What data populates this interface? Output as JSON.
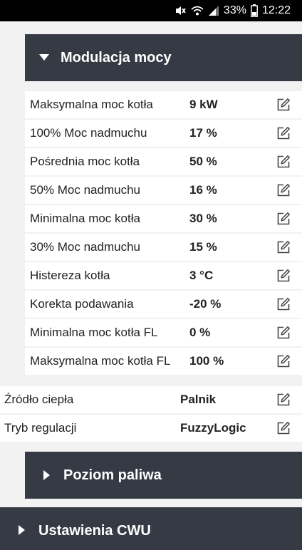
{
  "status_bar": {
    "battery": "33%",
    "time": "12:22"
  },
  "sections": {
    "modulacja": {
      "title": "Modulacja mocy",
      "expanded": true
    },
    "poziom": {
      "title": "Poziom paliwa",
      "expanded": false
    },
    "cwu": {
      "title": "Ustawienia CWU",
      "expanded": false
    }
  },
  "params": [
    {
      "label": "Maksymalna moc kotła",
      "value": "9 kW"
    },
    {
      "label": "100% Moc nadmuchu",
      "value": "17 %"
    },
    {
      "label": "Pośrednia moc kotła",
      "value": "50 %"
    },
    {
      "label": "50% Moc nadmuchu",
      "value": "16 %"
    },
    {
      "label": "Minimalna moc kotła",
      "value": "30 %"
    },
    {
      "label": "30% Moc nadmuchu",
      "value": "15 %"
    },
    {
      "label": "Histereza kotła",
      "value": "3 °C"
    },
    {
      "label": "Korekta podawania",
      "value": "-20 %"
    },
    {
      "label": "Minimalna moc kotła FL",
      "value": "0 %"
    },
    {
      "label": "Maksymalna moc kotła FL",
      "value": "100 %"
    }
  ],
  "extra": [
    {
      "label": "Źródło ciepła",
      "value": "Palnik"
    },
    {
      "label": "Tryb regulacji",
      "value": "FuzzyLogic"
    }
  ],
  "icons": {
    "edit": "edit-icon",
    "section_open": "triangle-down-icon",
    "section_closed": "triangle-right-icon"
  },
  "colors": {
    "header_bg": "#353a45",
    "page_bg": "#f2f2f2",
    "row_bg": "#ffffff"
  }
}
